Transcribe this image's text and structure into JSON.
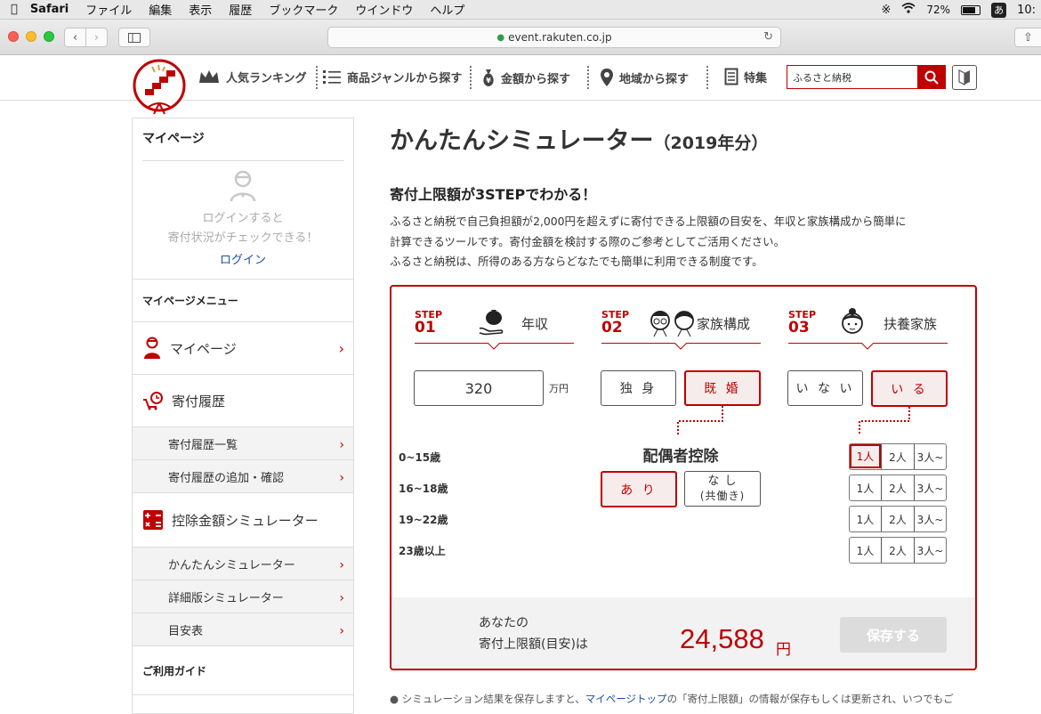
{
  "menubar": {
    "app": "Safari",
    "items": [
      "ファイル",
      "編集",
      "表示",
      "履歴",
      "ブックマーク",
      "ウインドウ",
      "ヘルプ"
    ],
    "battery": "72%",
    "ime": "あ",
    "clock": "10:"
  },
  "browser": {
    "url": "event.rakuten.co.jp"
  },
  "header": {
    "nav": [
      "人気ランキング",
      "商品ジャンルから探す",
      "金額から探す",
      "地域から探す",
      "特集"
    ],
    "search_value": "ふるさと納税"
  },
  "sidebar": {
    "title": "マイページ",
    "login_message_1": "ログインすると",
    "login_message_2": "寄付状況がチェックできる！",
    "login_link": "ログイン",
    "menu_heading": "マイページメニュー",
    "mypage": "マイページ",
    "history": "寄付履歴",
    "history_list": "寄付履歴一覧",
    "history_add": "寄付履歴の追加・確認",
    "sim": "控除金額シミュレーター",
    "sim_easy": "かんたんシミュレーター",
    "sim_detail": "詳細版シミュレーター",
    "sim_table": "目安表",
    "guide": "ご利用ガイド"
  },
  "main": {
    "title": "かんたんシミュレーター",
    "title_year": "（2019年分）",
    "subtitle": "寄付上限額が3STEPでわかる！",
    "desc_1": "ふるさと納税で自己負担額が2,000円を超えずに寄付できる上限額の目安を、年収と家族構成から簡単に",
    "desc_2": "計算できるツールです。寄付金額を検討する際のご参考としてご活用ください。",
    "desc_3": "ふるさと納税は、所得のある方ならどなたでも簡単に利用できる制度です。"
  },
  "steps": {
    "step_word": "STEP",
    "s1_num": "01",
    "s1_title": "年収",
    "s2_num": "02",
    "s2_title": "家族構成",
    "s3_num": "03",
    "s3_title": "扶養家族",
    "income_value": "320",
    "income_unit": "万円",
    "single": "独 身",
    "married": "既 婚",
    "marital_selected": "既 婚",
    "spouse_heading": "配偶者控除",
    "spouse_yes": "あ り",
    "spouse_no_1": "な し",
    "spouse_no_2": "(共働き)",
    "dep_none": "い な い",
    "dep_yes": "い る",
    "age_rows": [
      {
        "label": "0~15歳",
        "options": [
          "1人",
          "2人",
          "3人~"
        ],
        "selected": "1人"
      },
      {
        "label": "16~18歳",
        "options": [
          "1人",
          "2人",
          "3人~"
        ]
      },
      {
        "label": "19~22歳",
        "options": [
          "1人",
          "2人",
          "3人~"
        ]
      },
      {
        "label": "23歳以上",
        "options": [
          "1人",
          "2人",
          "3人~"
        ]
      }
    ]
  },
  "result": {
    "label_1": "あなたの",
    "label_2": "寄付上限額(目安)は",
    "amount": "24,588",
    "unit": "円",
    "save": "保存する"
  },
  "footnote": {
    "before": "シミュレーション結果を保存しますと、",
    "link": "マイページトップ",
    "after": "の「寄付上限額」の情報が保存もしくは更新され、いつでもご"
  },
  "colors": {
    "accent": "#bf0000",
    "link": "#1a4fa0"
  }
}
